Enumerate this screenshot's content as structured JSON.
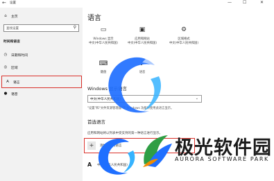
{
  "window": {
    "title": "设置",
    "back_icon": "back-arrow-icon",
    "controls": {
      "minimize": "—",
      "maximize": "☐",
      "close": "✕"
    }
  },
  "sidebar": {
    "home": {
      "icon": "home-icon",
      "label": "主页"
    },
    "search": {
      "placeholder": "查找设置"
    },
    "section_title": "时间和语言",
    "items": [
      {
        "icon": "clock-icon",
        "label": "日期和时间"
      },
      {
        "icon": "region-icon",
        "label": "区域"
      },
      {
        "icon": "language-icon",
        "label": "语言"
      },
      {
        "icon": "microphone-icon",
        "label": "语音"
      }
    ]
  },
  "main": {
    "title": "语言",
    "tiles": [
      {
        "icon": "monitor-icon",
        "label": "Windows 显示\n中文(中华人民共和国)"
      },
      {
        "icon": "apps-icon",
        "label": "应用和网站\n中文(中华人民共和国)"
      },
      {
        "icon": "date-format-icon",
        "label": "区域格式\n中文(中华人民共和国)"
      },
      {
        "icon": "keyboard-icon",
        "label": "键盘"
      },
      {
        "icon": "speech-icon",
        "label": "语音"
      }
    ],
    "display_section": {
      "heading": "Windows 显示语言",
      "selected": "中文(中华人民共和国)",
      "note": "\"设置\"和\"文件资源管理器\"等 Windows 功能将使用此语言显示。"
    },
    "preferred_section": {
      "heading": "首选语言",
      "description": "应用和网站将以列表中受支持的第一种语言进行显示。",
      "add_label": "添加首选的语言",
      "language_item": "中文(中华人民共和国)"
    }
  },
  "watermark": {
    "logo_text": "极光软件园",
    "logo_sub": "AURORA SOFTWARE PARK",
    "brand_color": "#1f6fff"
  }
}
